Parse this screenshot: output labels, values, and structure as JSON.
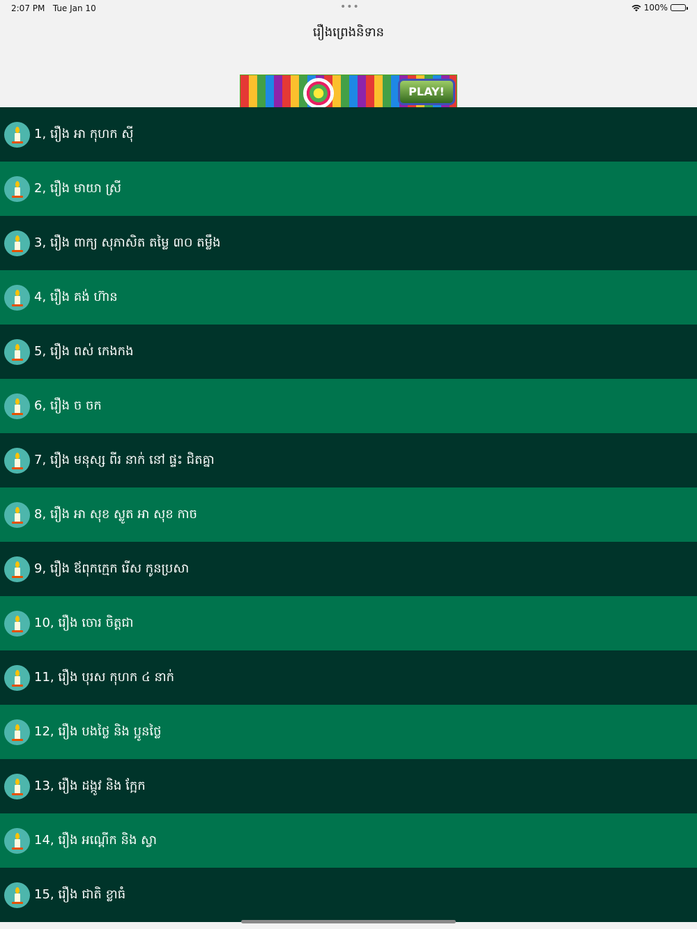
{
  "status_bar": {
    "time": "2:07 PM",
    "date": "Tue Jan 10",
    "battery": "100%",
    "battery_level": 1.0
  },
  "nav": {
    "title": "រឿងព្រេងនិទាន"
  },
  "ad": {
    "play_label": "PLAY!"
  },
  "colors": {
    "row_dark": "#00342a",
    "row_light": "#00744d",
    "icon_bg": "#4db6ac"
  },
  "list": {
    "icon": "candle-icon",
    "items": [
      {
        "label": "1, រឿង អា កុហក ស៊ី"
      },
      {
        "label": "2, រឿង មាយា ស្រី"
      },
      {
        "label": "3, រឿង ពាក្យ សុភាសិត តម្លៃ ៣០ តម្លឹង"
      },
      {
        "label": "4, រឿង គង់ ហ៊ាន"
      },
      {
        "label": "5, រឿង ពស់ កេងកង"
      },
      {
        "label": "6, រឿង ច ចក"
      },
      {
        "label": "7, រឿង មនុស្ស ពីរ នាក់ នៅ ផ្ទះ ជិតគ្នា"
      },
      {
        "label": "8, រឿង អា សុខ ស្លូត អា សុខ កាច"
      },
      {
        "label": "9, រឿង ឪពុកក្មេក រើស កូនប្រសា"
      },
      {
        "label": "10, រឿង ចោរ ចិត្តជា"
      },
      {
        "label": "11, រឿង បុរស កុហក ៤ នាក់"
      },
      {
        "label": "12, រឿង បងថ្លៃ និង ប្អូនថ្លៃ"
      },
      {
        "label": "13, រឿង ដង្កូវ និង ក្អែក"
      },
      {
        "label": "14, រឿង អណ្តើក និង ស្វា"
      },
      {
        "label": "15, រឿង ជាតិ ខ្លាធំ"
      }
    ]
  }
}
